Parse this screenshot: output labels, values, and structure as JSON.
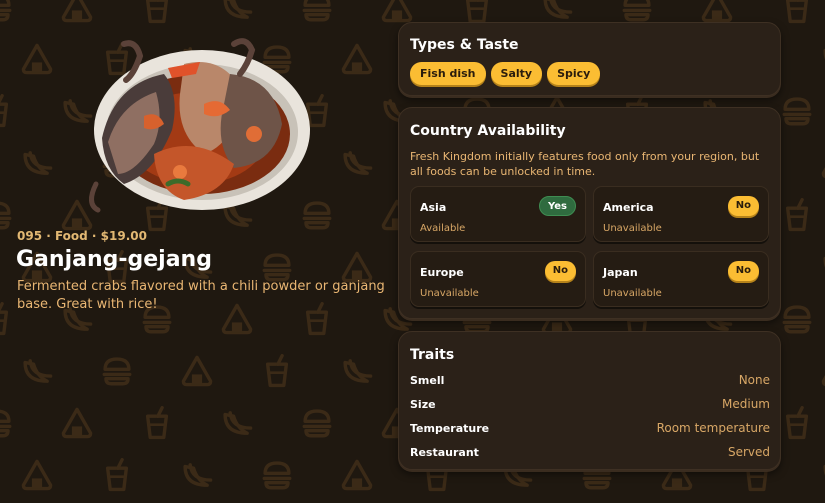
{
  "food": {
    "meta": "095 · Food · $19.00",
    "name": "Ganjang-gejang",
    "description": "Fermented crabs flavored with a chili powder or ganjang base. Great with rice!"
  },
  "types_card": {
    "title": "Types & Taste",
    "tags": [
      "Fish dish",
      "Salty",
      "Spicy"
    ]
  },
  "country_card": {
    "title": "Country Availability",
    "note": "Fresh Kingdom initially features food only from your region, but all foods can be unlocked in time.",
    "countries": [
      {
        "name": "Asia",
        "badge": "Yes",
        "status": "Available"
      },
      {
        "name": "America",
        "badge": "No",
        "status": "Unavailable"
      },
      {
        "name": "Europe",
        "badge": "No",
        "status": "Unavailable"
      },
      {
        "name": "Japan",
        "badge": "No",
        "status": "Unavailable"
      }
    ]
  },
  "traits_card": {
    "title": "Traits",
    "rows": [
      {
        "label": "Smell",
        "value": "None"
      },
      {
        "label": "Size",
        "value": "Medium"
      },
      {
        "label": "Temperature",
        "value": "Room temperature"
      },
      {
        "label": "Restaurant",
        "value": "Served"
      }
    ]
  },
  "colors": {
    "background": "#1f1810",
    "pattern_icon": "#3b2a17",
    "card": "#2b2118",
    "accent_yellow": "#fbbd33",
    "accent_green": "#2f6b3f",
    "text_tan": "#e9b673"
  },
  "icons": {
    "background_pattern": [
      "burger-icon",
      "onigiri-icon",
      "drink-cup-icon",
      "banana-icon"
    ],
    "food_image": "crab-dish-image"
  }
}
